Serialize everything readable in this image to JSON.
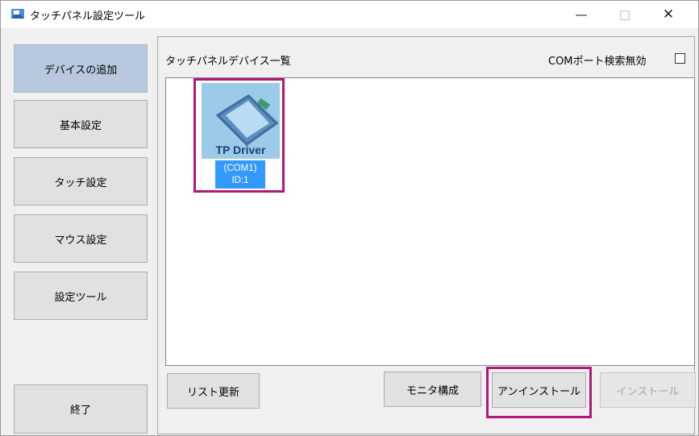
{
  "window": {
    "title": "タッチパネル設定ツール",
    "minimize_glyph": "—",
    "maximize_glyph": "□",
    "close_glyph": "✕"
  },
  "sidebar": {
    "items": [
      {
        "label": "デバイスの追加",
        "active": true
      },
      {
        "label": "基本設定"
      },
      {
        "label": "タッチ設定"
      },
      {
        "label": "マウス設定"
      },
      {
        "label": "設定ツール"
      }
    ],
    "exit_label": "終了"
  },
  "main": {
    "list_title": "タッチパネルデバイス一覧",
    "com_search_label": "COMポート検索無効",
    "com_search_checked": false,
    "devices": [
      {
        "name": "TP Driver",
        "port": "(COM1)",
        "id": "ID:1",
        "selected": true
      }
    ],
    "buttons": {
      "refresh": "リスト更新",
      "monitor": "モニタ構成",
      "uninstall": "アンインストール",
      "install": "インストール"
    }
  },
  "colors": {
    "highlight_frame": "#b0187a",
    "selection": "#3399ff",
    "active_nav": "#b8c9df"
  },
  "icons": {
    "app": "app-touch-icon",
    "device": "touch-panel-icon"
  }
}
